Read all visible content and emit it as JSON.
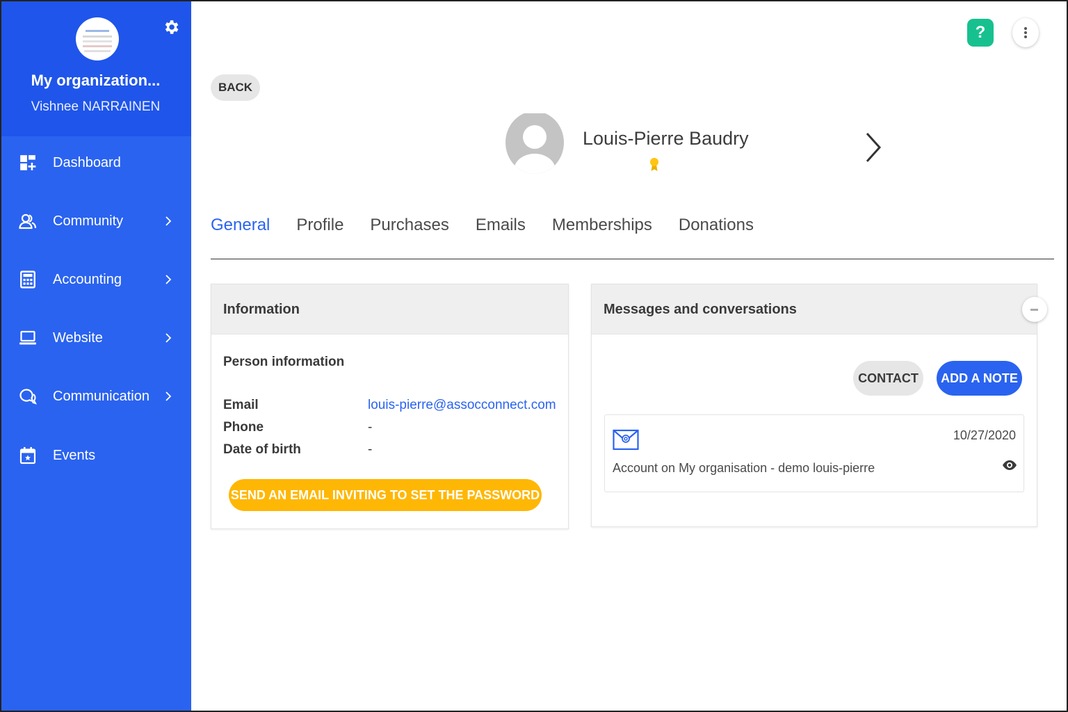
{
  "sidebar": {
    "org_name": "My organization...",
    "user_name": "Vishnee NARRAINEN",
    "items": [
      {
        "label": "Dashboard",
        "icon": "dashboard-icon",
        "has_submenu": false
      },
      {
        "label": "Community",
        "icon": "community-icon",
        "has_submenu": true
      },
      {
        "label": "Accounting",
        "icon": "calculator-icon",
        "has_submenu": true
      },
      {
        "label": "Website",
        "icon": "laptop-icon",
        "has_submenu": true
      },
      {
        "label": "Communication",
        "icon": "chat-icon",
        "has_submenu": true
      },
      {
        "label": "Events",
        "icon": "calendar-icon",
        "has_submenu": false
      }
    ],
    "bg_color": "#2a63f0"
  },
  "header": {
    "help_label": "?",
    "back_label": "BACK"
  },
  "person": {
    "name": "Louis-Pierre Baudry"
  },
  "tabs": [
    {
      "label": "General",
      "active": true
    },
    {
      "label": "Profile",
      "active": false
    },
    {
      "label": "Purchases",
      "active": false
    },
    {
      "label": "Emails",
      "active": false
    },
    {
      "label": "Memberships",
      "active": false
    },
    {
      "label": "Donations",
      "active": false
    }
  ],
  "info_card": {
    "title": "Information",
    "subtitle": "Person information",
    "rows": [
      {
        "label": "Email",
        "value": "louis-pierre@assocconnect.com"
      },
      {
        "label": "Phone",
        "value": "-"
      },
      {
        "label": "Date of birth",
        "value": "-"
      }
    ],
    "invite_button": "SEND AN EMAIL INVITING TO SET THE PASSWORD"
  },
  "messages_card": {
    "title": "Messages and conversations",
    "contact_button": "CONTACT",
    "note_button": "ADD A NOTE",
    "items": [
      {
        "date": "10/27/2020",
        "subject": "Account on My organisation - demo louis-pierre"
      }
    ]
  },
  "colors": {
    "accent": "#2a63f0",
    "help": "#17c18f",
    "warning": "#ffb705"
  }
}
